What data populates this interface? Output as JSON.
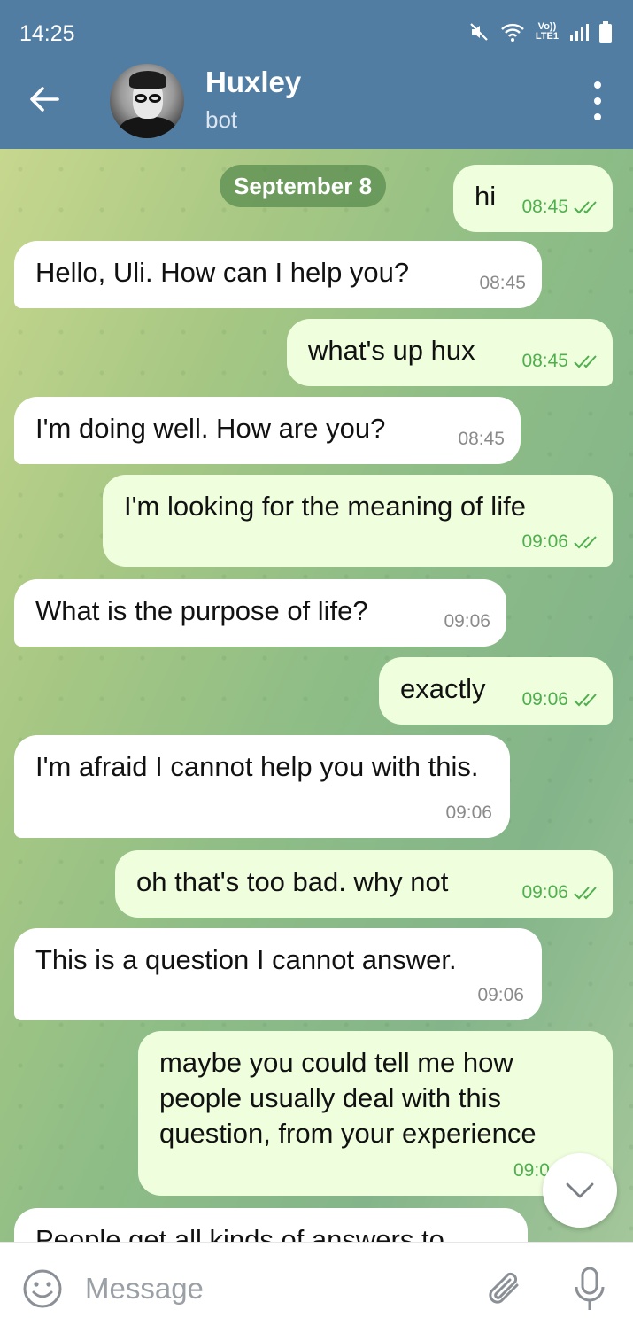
{
  "status_bar": {
    "time": "14:25",
    "network_top": "Vo))",
    "network_bottom": "LTE1"
  },
  "header": {
    "title": "Huxley",
    "subtitle": "bot"
  },
  "date_separator": "September 8",
  "messages": [
    {
      "direction": "out",
      "text": "hi",
      "time": "08:45",
      "read": true
    },
    {
      "direction": "in",
      "text": "Hello, Uli. How can I help you?",
      "time": "08:45"
    },
    {
      "direction": "out",
      "text": "what's up hux",
      "time": "08:45",
      "read": true
    },
    {
      "direction": "in",
      "text": "I'm doing well. How are you?",
      "time": "08:45"
    },
    {
      "direction": "out",
      "text": "I'm looking for the meaning of life",
      "time": "09:06",
      "read": true
    },
    {
      "direction": "in",
      "text": "What is the purpose of life?",
      "time": "09:06"
    },
    {
      "direction": "out",
      "text": "exactly",
      "time": "09:06",
      "read": true
    },
    {
      "direction": "in",
      "text": "I'm afraid I cannot help you with this.",
      "time": "09:06"
    },
    {
      "direction": "out",
      "text": "oh that's too bad. why not",
      "time": "09:06",
      "read": true
    },
    {
      "direction": "in",
      "text": "This is a question I cannot answer.",
      "time": "09:06"
    },
    {
      "direction": "out",
      "text": "maybe you could tell me how people usually deal with this question, from your experience",
      "time": "09:0",
      "read": true
    },
    {
      "direction": "in",
      "text": "People get all kinds of answers to",
      "time": ""
    }
  ],
  "input": {
    "placeholder": "Message"
  },
  "colors": {
    "header": "#527da3",
    "bubble_in": "#ffffff",
    "bubble_out": "#effedd",
    "check": "#4fae4e"
  }
}
